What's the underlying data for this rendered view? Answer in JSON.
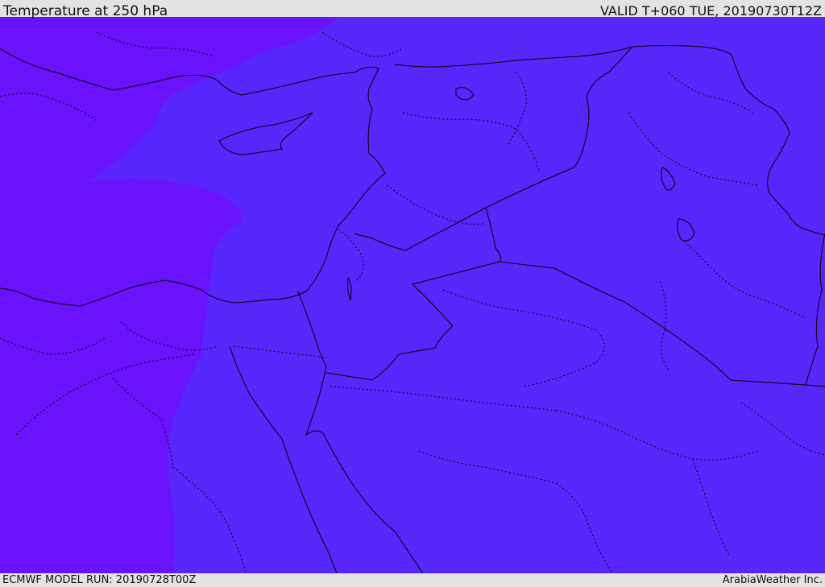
{
  "header": {
    "title": "Temperature at 250 hPa",
    "valid": "VALID T+060 TUE, 20190730T12Z"
  },
  "footer": {
    "model_run": "ECMWF MODEL RUN: 20190728T00Z",
    "credit": "ArabiaWeather Inc."
  },
  "colors": {
    "field_west": "#6a12fb",
    "field_east": "#5726fb",
    "boundary": "#000000"
  }
}
